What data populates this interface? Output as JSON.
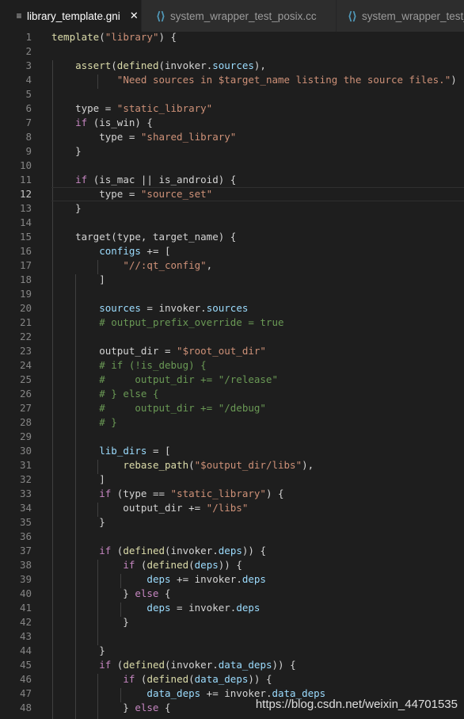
{
  "tabs": [
    {
      "label": "library_template.gni",
      "icon": "file-lines-icon",
      "active": true,
      "close": "✕"
    },
    {
      "label": "system_wrapper_test_posix.cc",
      "icon": "cpp-file-icon",
      "active": false
    },
    {
      "label": "system_wrapper_test_",
      "icon": "cpp-file-icon",
      "active": false
    }
  ],
  "current_line": 12,
  "lines": [
    [
      [
        "template",
        "f"
      ],
      [
        "(",
        ""
      ],
      [
        "\"library\"",
        "s"
      ],
      [
        ") {",
        ""
      ]
    ],
    [],
    [
      [
        "    ",
        ""
      ],
      [
        "assert",
        "f"
      ],
      [
        "(",
        ""
      ],
      [
        "defined",
        "f"
      ],
      [
        "(invoker.",
        ""
      ],
      [
        "sources",
        "v"
      ],
      [
        "),",
        ""
      ]
    ],
    [
      [
        "           ",
        ""
      ],
      [
        "\"Need sources in $target_name listing the source files.\"",
        "s"
      ],
      [
        ")",
        ""
      ]
    ],
    [],
    [
      [
        "    type = ",
        ""
      ],
      [
        "\"static_library\"",
        "s"
      ]
    ],
    [
      [
        "    ",
        ""
      ],
      [
        "if",
        "k"
      ],
      [
        " (is_win) {",
        ""
      ]
    ],
    [
      [
        "        type = ",
        ""
      ],
      [
        "\"shared_library\"",
        "s"
      ]
    ],
    [
      [
        "    }",
        ""
      ]
    ],
    [],
    [
      [
        "    ",
        ""
      ],
      [
        "if",
        "k"
      ],
      [
        " (is_mac || is_android) {",
        ""
      ]
    ],
    [
      [
        "        type = ",
        ""
      ],
      [
        "\"source_set\"",
        "s"
      ]
    ],
    [
      [
        "    }",
        ""
      ]
    ],
    [],
    [
      [
        "    target(type, target_name) {",
        ""
      ]
    ],
    [
      [
        "        ",
        ""
      ],
      [
        "configs",
        "v"
      ],
      [
        " += [",
        ""
      ]
    ],
    [
      [
        "            ",
        ""
      ],
      [
        "\"//:qt_config\"",
        "s"
      ],
      [
        ",",
        ""
      ]
    ],
    [
      [
        "        ]",
        ""
      ]
    ],
    [],
    [
      [
        "        ",
        ""
      ],
      [
        "sources",
        "v"
      ],
      [
        " = invoker.",
        ""
      ],
      [
        "sources",
        "v"
      ]
    ],
    [
      [
        "        ",
        ""
      ],
      [
        "# output_prefix_override = true",
        "c"
      ]
    ],
    [],
    [
      [
        "        output_dir = ",
        ""
      ],
      [
        "\"$root_out_dir\"",
        "s"
      ]
    ],
    [
      [
        "        ",
        ""
      ],
      [
        "# if (!is_debug) {",
        "c"
      ]
    ],
    [
      [
        "        ",
        ""
      ],
      [
        "#     output_dir += \"/release\"",
        "c"
      ]
    ],
    [
      [
        "        ",
        ""
      ],
      [
        "# } else {",
        "c"
      ]
    ],
    [
      [
        "        ",
        ""
      ],
      [
        "#     output_dir += \"/debug\"",
        "c"
      ]
    ],
    [
      [
        "        ",
        ""
      ],
      [
        "# }",
        "c"
      ]
    ],
    [],
    [
      [
        "        ",
        ""
      ],
      [
        "lib_dirs",
        "v"
      ],
      [
        " = [",
        ""
      ]
    ],
    [
      [
        "            ",
        ""
      ],
      [
        "rebase_path",
        "f"
      ],
      [
        "(",
        ""
      ],
      [
        "\"$output_dir/libs\"",
        "s"
      ],
      [
        "),",
        ""
      ]
    ],
    [
      [
        "        ]",
        ""
      ]
    ],
    [
      [
        "        ",
        ""
      ],
      [
        "if",
        "k"
      ],
      [
        " (type == ",
        ""
      ],
      [
        "\"static_library\"",
        "s"
      ],
      [
        ") {",
        ""
      ]
    ],
    [
      [
        "            output_dir += ",
        ""
      ],
      [
        "\"/libs\"",
        "s"
      ]
    ],
    [
      [
        "        }",
        ""
      ]
    ],
    [],
    [
      [
        "        ",
        ""
      ],
      [
        "if",
        "k"
      ],
      [
        " (",
        ""
      ],
      [
        "defined",
        "f"
      ],
      [
        "(invoker.",
        ""
      ],
      [
        "deps",
        "v"
      ],
      [
        ")) {",
        ""
      ]
    ],
    [
      [
        "            ",
        ""
      ],
      [
        "if",
        "k"
      ],
      [
        " (",
        ""
      ],
      [
        "defined",
        "f"
      ],
      [
        "(",
        ""
      ],
      [
        "deps",
        "v"
      ],
      [
        ")) {",
        ""
      ]
    ],
    [
      [
        "                ",
        ""
      ],
      [
        "deps",
        "v"
      ],
      [
        " += invoker.",
        ""
      ],
      [
        "deps",
        "v"
      ]
    ],
    [
      [
        "            } ",
        ""
      ],
      [
        "else",
        "k"
      ],
      [
        " {",
        ""
      ]
    ],
    [
      [
        "                ",
        ""
      ],
      [
        "deps",
        "v"
      ],
      [
        " = invoker.",
        ""
      ],
      [
        "deps",
        "v"
      ]
    ],
    [
      [
        "            }",
        ""
      ]
    ],
    [],
    [
      [
        "        }",
        ""
      ]
    ],
    [
      [
        "        ",
        ""
      ],
      [
        "if",
        "k"
      ],
      [
        " (",
        ""
      ],
      [
        "defined",
        "f"
      ],
      [
        "(invoker.",
        ""
      ],
      [
        "data_deps",
        "v"
      ],
      [
        ")) {",
        ""
      ]
    ],
    [
      [
        "            ",
        ""
      ],
      [
        "if",
        "k"
      ],
      [
        " (",
        ""
      ],
      [
        "defined",
        "f"
      ],
      [
        "(",
        ""
      ],
      [
        "data_deps",
        "v"
      ],
      [
        ")) {",
        ""
      ]
    ],
    [
      [
        "                ",
        ""
      ],
      [
        "data_deps",
        "v"
      ],
      [
        " += invoker.",
        ""
      ],
      [
        "data_deps",
        "v"
      ]
    ],
    [
      [
        "            } ",
        ""
      ],
      [
        "else",
        "k"
      ],
      [
        " {",
        ""
      ]
    ]
  ],
  "watermark": "https://blog.csdn.net/weixin_44701535"
}
